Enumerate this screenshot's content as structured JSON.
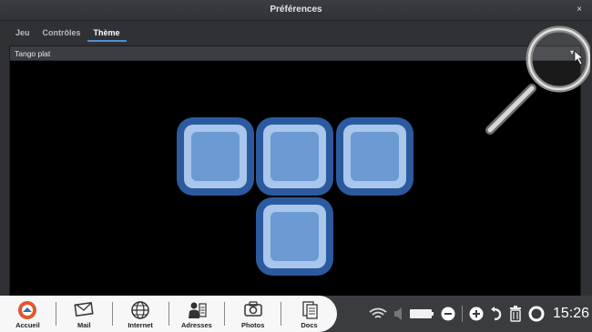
{
  "window": {
    "title": "Préférences",
    "close_label": "×"
  },
  "tabs": [
    {
      "label": "Jeu",
      "active": false
    },
    {
      "label": "Contrôles",
      "active": false
    },
    {
      "label": "Thème",
      "active": true
    }
  ],
  "theme_select": {
    "value": "Tango plat",
    "arrow": "▾"
  },
  "preview": {
    "block_color": "#6b9bd2",
    "block_border": "#2c5a9e",
    "block_rim": "#a9c6eb",
    "background": "#000000"
  },
  "dock": {
    "items": [
      {
        "label": "Accueil",
        "icon": "home-icon"
      },
      {
        "label": "Mail",
        "icon": "mail-icon"
      },
      {
        "label": "Internet",
        "icon": "globe-icon"
      },
      {
        "label": "Adresses",
        "icon": "contacts-icon"
      },
      {
        "label": "Photos",
        "icon": "camera-icon"
      },
      {
        "label": "Docs",
        "icon": "documents-icon"
      }
    ]
  },
  "tray": {
    "clock": "15:26"
  }
}
